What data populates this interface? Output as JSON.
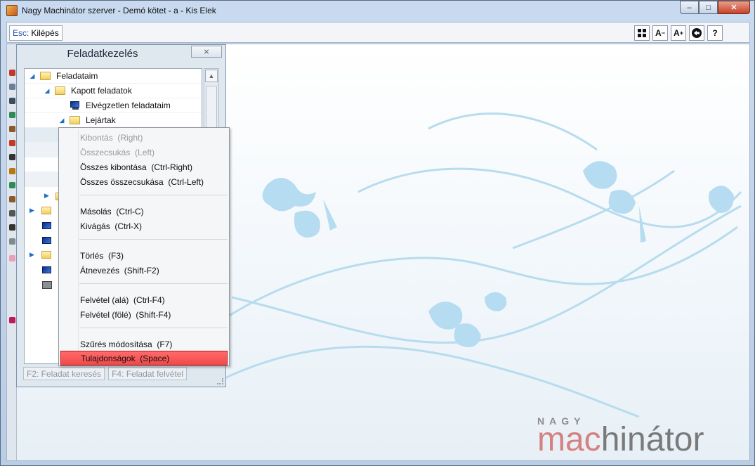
{
  "window": {
    "title": "Nagy Machinátor szerver - Demó kötet - a - Kis Elek",
    "controls": {
      "minimize": "–",
      "maximize": "□",
      "close": "✕"
    }
  },
  "toolbar": {
    "esc_key": "Esc:",
    "esc_label": "Kilépés",
    "icons": [
      "layout-grid-icon",
      "font-decrease-icon",
      "font-increase-icon",
      "navigate-icon",
      "help-icon"
    ],
    "icon_glyphs": {
      "font_decrease": "A",
      "font_increase": "A",
      "help": "?"
    }
  },
  "panel": {
    "title": "Feladatkezelés",
    "close_glyph": "⨯",
    "tree": [
      {
        "label": "Feladataim",
        "icon": "folder",
        "expanded": true
      },
      {
        "label": "Kapott feladatok",
        "icon": "folder",
        "expanded": true
      },
      {
        "label": "Elvégzetlen feladataim",
        "icon": "monitor"
      },
      {
        "label": "Lejártak",
        "icon": "folder",
        "expanded": true
      }
    ],
    "footer": {
      "search": "F2: Feladat keresés",
      "add": "F4: Feladat felvétel"
    }
  },
  "context_menu": {
    "items": [
      {
        "label": "Kibontás  (Right)",
        "enabled": false
      },
      {
        "label": "Összecsukás  (Left)",
        "enabled": false
      },
      {
        "label": "Összes kibontása  (Ctrl-Right)",
        "enabled": true
      },
      {
        "label": "Összes összecsukása  (Ctrl-Left)",
        "enabled": true
      },
      {
        "label": "Másolás  (Ctrl-C)",
        "enabled": true
      },
      {
        "label": "Kivágás  (Ctrl-X)",
        "enabled": true
      },
      {
        "label": "Törlés  (F3)",
        "enabled": true
      },
      {
        "label": "Átnevezés  (Shift-F2)",
        "enabled": true
      },
      {
        "label": "Felvétel (alá)  (Ctrl-F4)",
        "enabled": true
      },
      {
        "label": "Felvétel (fölé)  (Shift-F4)",
        "enabled": true
      },
      {
        "label": "Szűrés módosítása  (F7)",
        "enabled": true
      },
      {
        "label": "Tulajdonságok  (Space)",
        "enabled": true,
        "highlighted": true
      }
    ]
  },
  "logo": {
    "top": "NAGY",
    "part1": "mac",
    "part2": "hinátor"
  },
  "colors": {
    "highlight": "#f24848",
    "accent_blue": "#1f6fc7",
    "logo_pink": "#d58181",
    "logo_gray": "#7a7a7a"
  }
}
